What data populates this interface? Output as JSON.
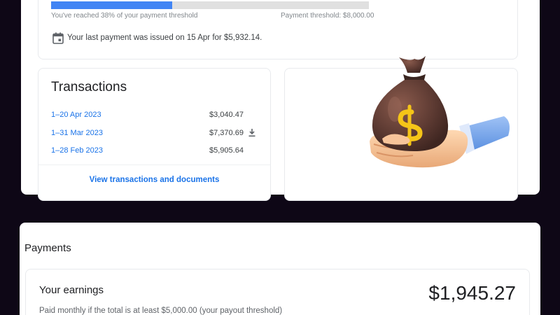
{
  "threshold_card": {
    "progress": 0.38,
    "reached_text": "You've reached 38% of your payment threshold",
    "threshold_text": "Payment threshold: $8,000.00",
    "last_payment_text": "Your last payment was issued on 15 Apr for $5,932.14."
  },
  "transactions": {
    "title": "Transactions",
    "rows": [
      {
        "period": "1–20 Apr 2023",
        "amount": "$3,040.47",
        "download": false
      },
      {
        "period": "1–31 Mar 2023",
        "amount": "$7,370.69",
        "download": true
      },
      {
        "period": "1–28 Feb 2023",
        "amount": "$5,905.64",
        "download": false
      }
    ],
    "link_label": "View transactions and documents"
  },
  "payments": {
    "heading": "Payments",
    "earnings_label": "Your earnings",
    "earnings_amount": "$1,945.27",
    "earnings_note": "Paid monthly if the total is at least $5,000.00 (your payout threshold)"
  },
  "colors": {
    "page_background": "#0e0716",
    "progress_fill": "#4285f4",
    "link": "#1a73e8"
  },
  "icons": {
    "calendar": "calendar-icon",
    "download": "download-icon",
    "illustration": "money-bag-hand-illustration"
  }
}
